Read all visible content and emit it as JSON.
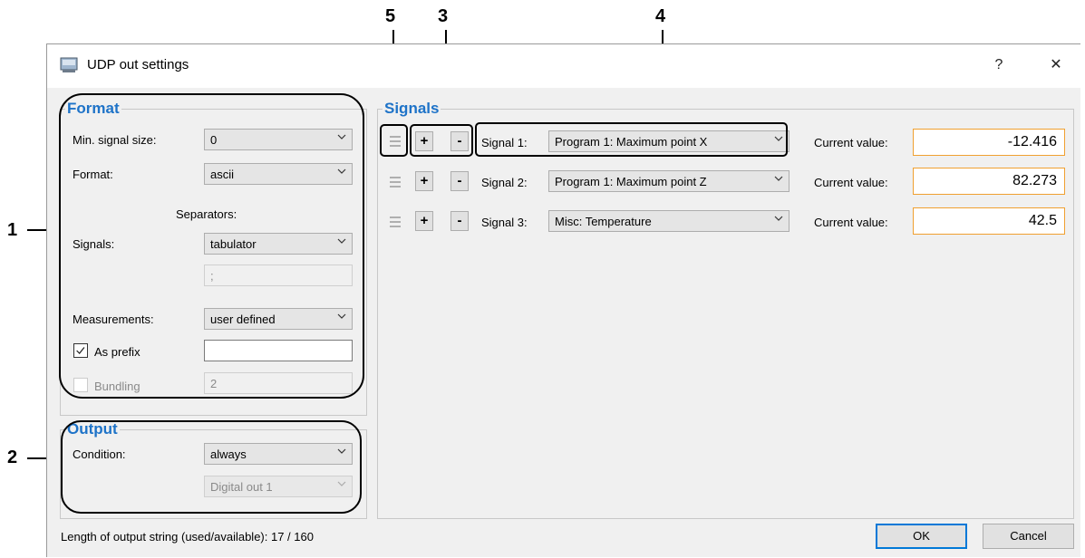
{
  "callouts": [
    "1",
    "2",
    "3",
    "4",
    "5"
  ],
  "window": {
    "title": "UDP out settings",
    "help": "?",
    "close": "✕"
  },
  "format": {
    "legend": "Format",
    "min_signal_size_label": "Min. signal size:",
    "min_signal_size_value": "0",
    "format_label": "Format:",
    "format_value": "ascii",
    "separators_heading": "Separators:",
    "signals_label": "Signals:",
    "signals_value": "tabulator",
    "signals_custom_value": ";",
    "measurements_label": "Measurements:",
    "measurements_value": "user defined",
    "as_prefix_label": "As prefix",
    "as_prefix_checked": true,
    "as_prefix_value": "",
    "bundling_label": "Bundling",
    "bundling_checked": false,
    "bundling_value": "2"
  },
  "output": {
    "legend": "Output",
    "condition_label": "Condition:",
    "condition_value": "always",
    "digital_out_value": "Digital out 1"
  },
  "signals": {
    "legend": "Signals",
    "add_symbol": "+",
    "remove_symbol": "-",
    "current_value_label": "Current value:",
    "rows": [
      {
        "label": "Signal 1:",
        "source": "Program 1: Maximum point X",
        "value": "-12.416"
      },
      {
        "label": "Signal 2:",
        "source": "Program 1: Maximum point Z",
        "value": "82.273"
      },
      {
        "label": "Signal 3:",
        "source": "Misc: Temperature",
        "value": "42.5"
      }
    ]
  },
  "footer": {
    "length_text": "Length of output string (used/available): 17 / 160",
    "ok_label": "OK",
    "cancel_label": "Cancel"
  },
  "colors": {
    "legend": "#1e73c8",
    "value_border": "#f0a030",
    "default_button": "#0078d7"
  }
}
